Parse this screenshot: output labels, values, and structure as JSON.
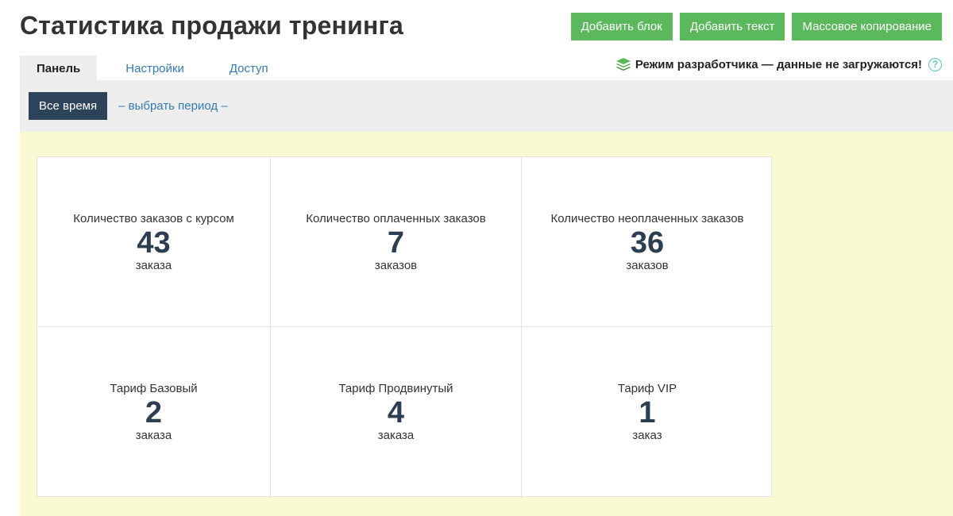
{
  "header": {
    "title": "Статистика продажи тренинга",
    "buttons": [
      "Добавить блок",
      "Добавить текст",
      "Массовое копирование"
    ]
  },
  "tabs": [
    {
      "label": "Панель",
      "active": true
    },
    {
      "label": "Настройки",
      "active": false
    },
    {
      "label": "Доступ",
      "active": false
    }
  ],
  "dev_mode": {
    "icon": "stack-icon",
    "text": "Режим разработчика — данные не загружаются!",
    "help": "?"
  },
  "period": {
    "button": "Все время",
    "link": "– выбрать период –"
  },
  "stats": [
    {
      "label": "Количество заказов с курсом",
      "value": "43",
      "unit": "заказа"
    },
    {
      "label": "Количество оплаченных заказов",
      "value": "7",
      "unit": "заказов"
    },
    {
      "label": "Количество неоплаченных заказов",
      "value": "36",
      "unit": "заказов"
    },
    {
      "label": "Тариф Базовый",
      "value": "2",
      "unit": "заказа"
    },
    {
      "label": "Тариф Продвинутый",
      "value": "4",
      "unit": "заказа"
    },
    {
      "label": "Тариф VIP",
      "value": "1",
      "unit": "заказ"
    }
  ],
  "colors": {
    "primary_green": "#5cb85c",
    "dark_navy": "#2d435a",
    "link_blue": "#337ab7",
    "content_bg": "#fafad2"
  }
}
